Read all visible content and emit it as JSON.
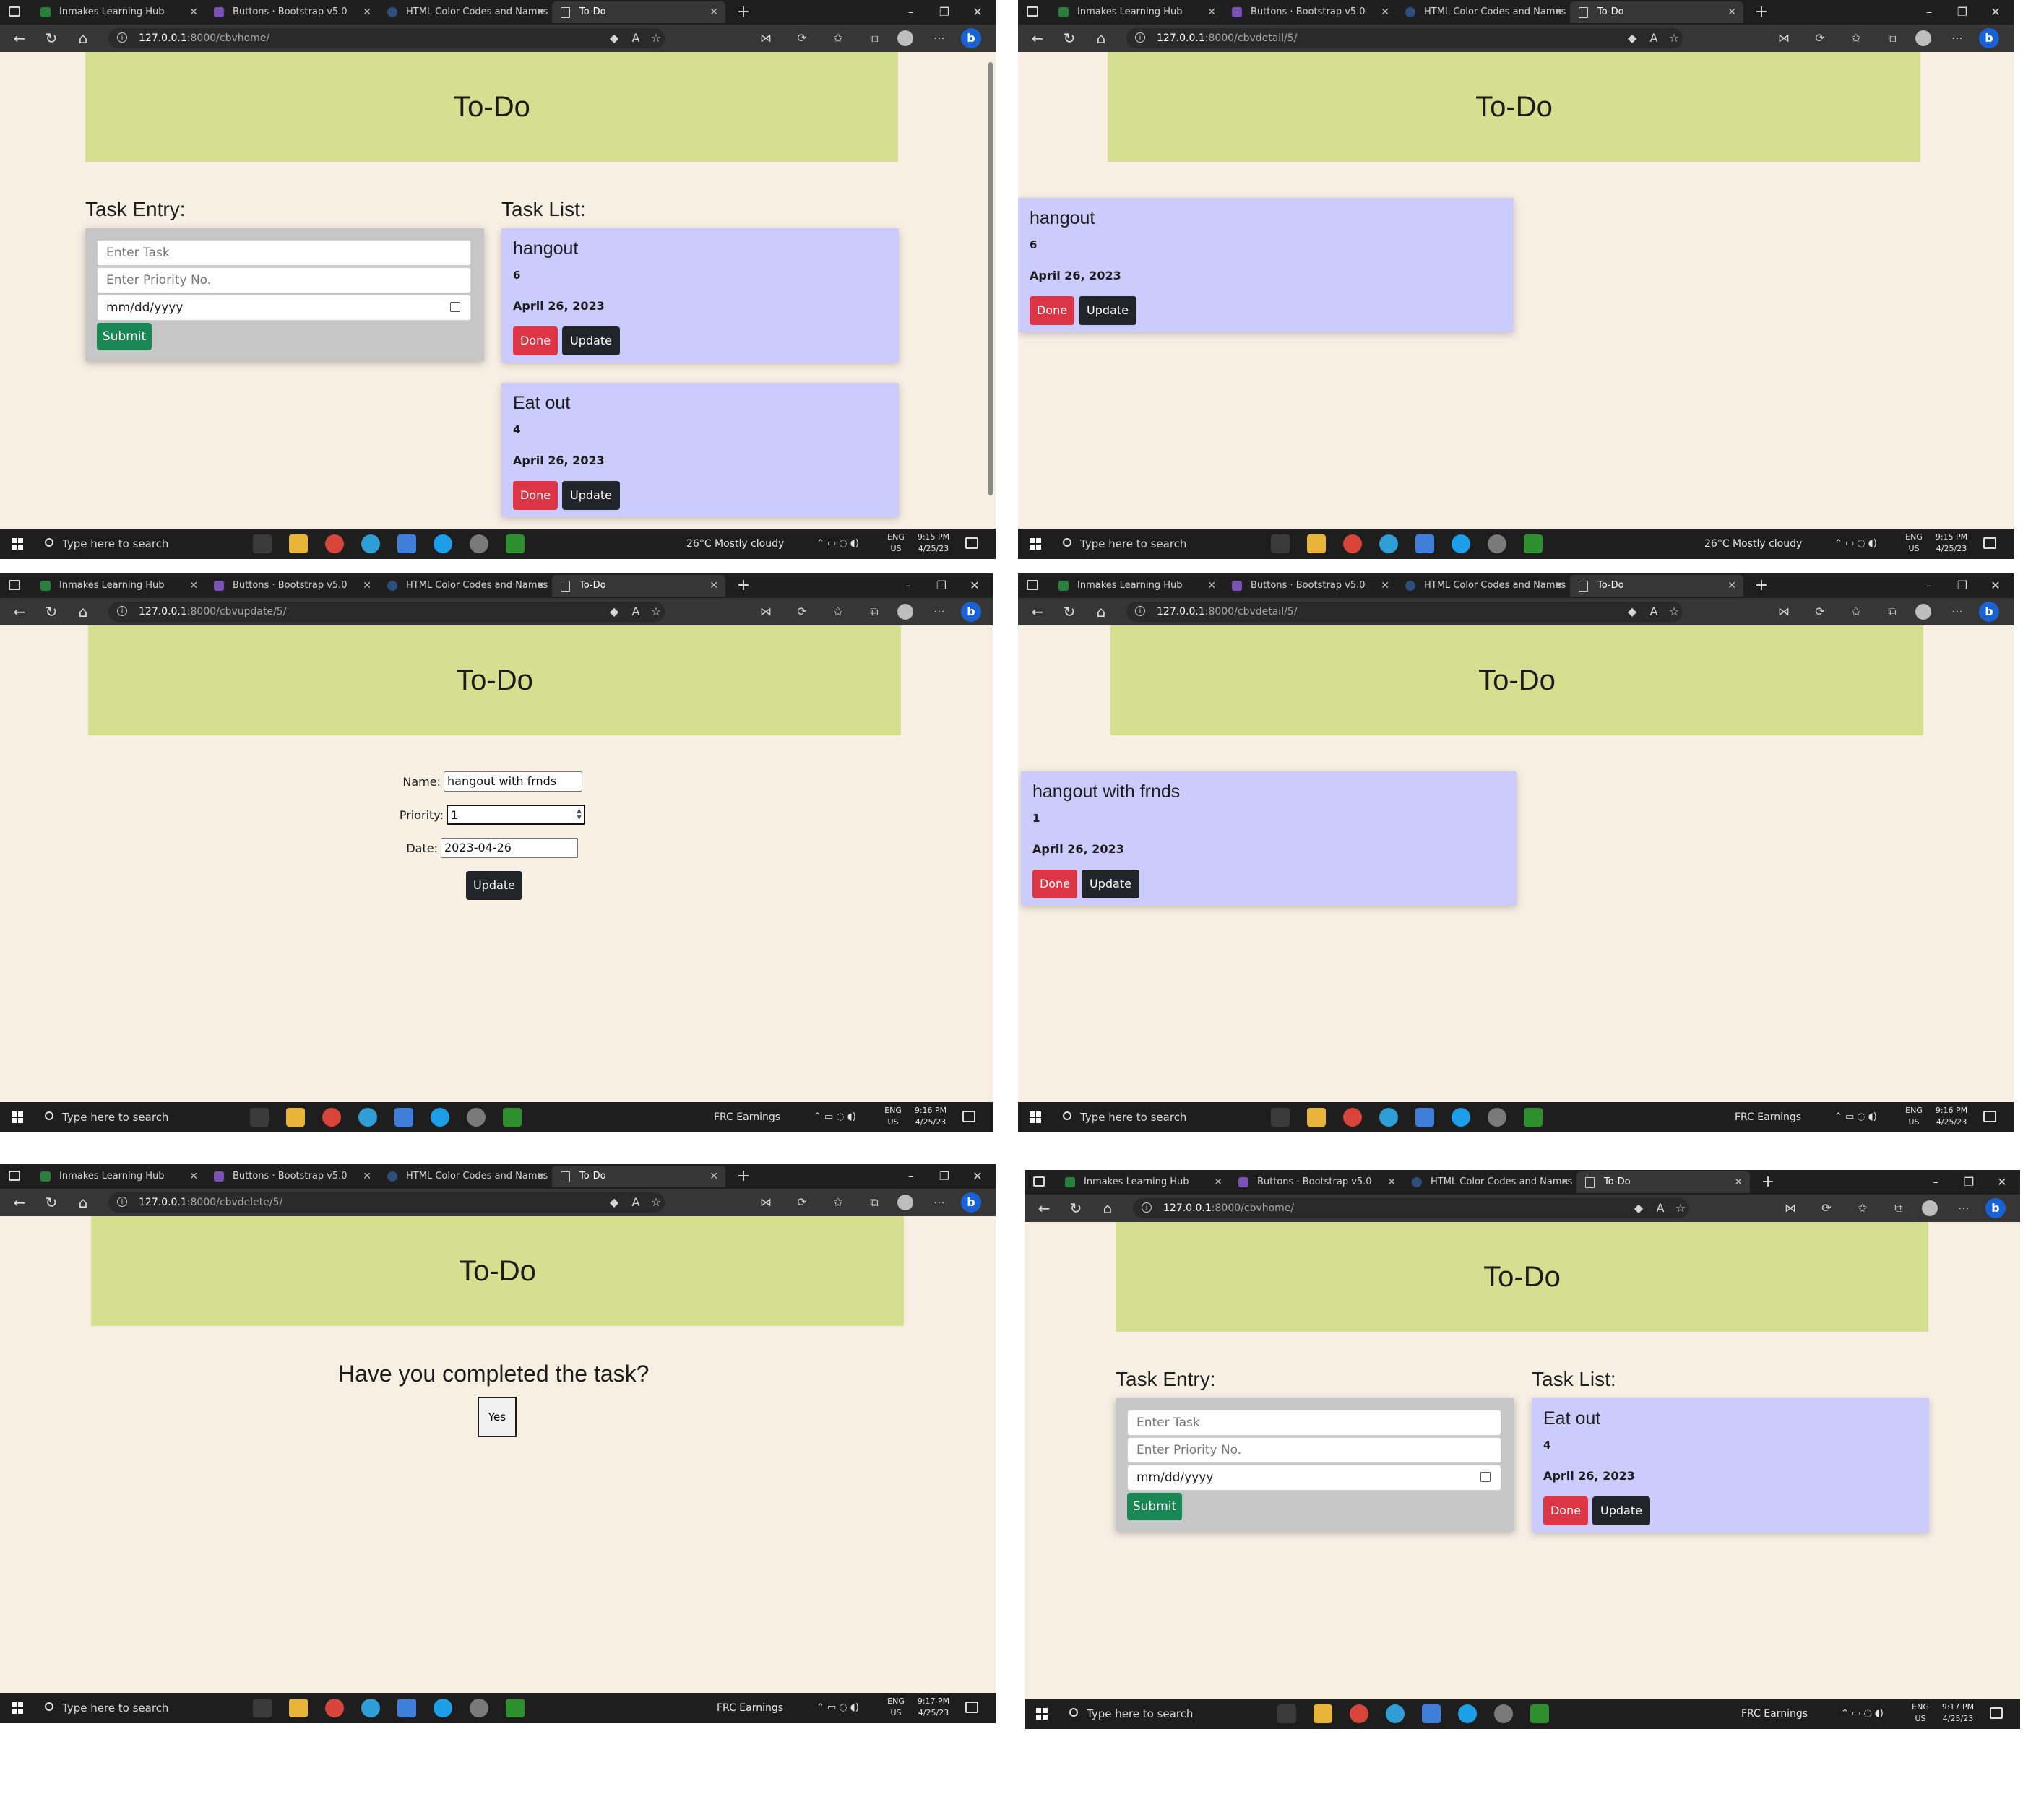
{
  "browser": {
    "tabs": [
      "Inmakes Learning Hub",
      "Buttons · Bootstrap v5.0",
      "HTML Color Codes and Names",
      "To-Do"
    ],
    "tab_close": "✕",
    "new_tab": "+"
  },
  "site": {
    "title": "To-Do",
    "host": "127.0.0.1",
    "port": ":8000"
  },
  "panels": [
    {
      "path": "/cbvhome/",
      "clock": {
        "time": "9:15 PM",
        "date": "4/25/23"
      },
      "tray": {
        "weather": "26°C  Mostly cloudy"
      }
    },
    {
      "path": "/cbvdetail/5/",
      "clock": {
        "time": "9:15 PM",
        "date": "4/25/23"
      },
      "tray": {
        "weather": "26°C  Mostly cloudy"
      }
    },
    {
      "path": "/cbvupdate/5/",
      "clock": {
        "time": "9:16 PM",
        "date": "4/25/23"
      },
      "tray": {
        "weather": "FRC  Earnings"
      }
    },
    {
      "path": "/cbvdetail/5/",
      "clock": {
        "time": "9:16 PM",
        "date": "4/25/23"
      },
      "tray": {
        "weather": "FRC  Earnings"
      }
    },
    {
      "path": "/cbvdelete/5/",
      "clock": {
        "time": "9:17 PM",
        "date": "4/25/23"
      },
      "tray": {
        "weather": "FRC  Earnings"
      }
    },
    {
      "path": "/cbvhome/",
      "clock": {
        "time": "9:17 PM",
        "date": "4/25/23"
      },
      "tray": {
        "weather": "FRC  Earnings"
      }
    }
  ],
  "taskbar": {
    "search_placeholder": "Type here to search",
    "lang_1": "ENG",
    "lang_2": "US"
  },
  "entry": {
    "heading": "Task Entry:",
    "task_placeholder": "Enter Task",
    "priority_placeholder": "Enter Priority No.",
    "date_placeholder": "mm/dd/yyyy",
    "submit_label": "Submit"
  },
  "list": {
    "heading": "Task List:"
  },
  "tasks": {
    "hangout": {
      "name": "hangout",
      "priority": "6",
      "date": "April 26, 2023"
    },
    "eat_out": {
      "name": "Eat out",
      "priority": "4",
      "date": "April 26, 2023"
    },
    "hangout_updated": {
      "name": "hangout with frnds",
      "priority": "1",
      "date": "April 26, 2023"
    }
  },
  "buttons": {
    "done": "Done",
    "update": "Update",
    "yes": "Yes"
  },
  "update_form": {
    "name_label": "Name:",
    "name_value": "hangout with frnds",
    "priority_label": "Priority:",
    "priority_value": "1",
    "date_label": "Date:",
    "date_value": "2023-04-26"
  },
  "delete_page": {
    "question": "Have you completed the task?"
  }
}
